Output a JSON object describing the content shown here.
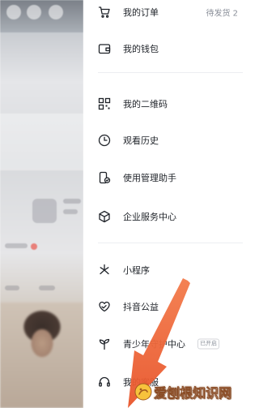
{
  "drawer": {
    "items": [
      {
        "key": "orders",
        "label": "我的订单",
        "icon": "cart-icon",
        "badge": "待发货 2"
      },
      {
        "key": "wallet",
        "label": "我的钱包",
        "icon": "wallet-icon"
      },
      {
        "key": "qrcode",
        "label": "我的二维码",
        "icon": "qrcode-icon"
      },
      {
        "key": "history",
        "label": "观看历史",
        "icon": "clock-icon"
      },
      {
        "key": "guardian",
        "label": "使用管理助手",
        "icon": "phone-shield-icon"
      },
      {
        "key": "enterprise",
        "label": "企业服务中心",
        "icon": "cube-icon"
      },
      {
        "key": "miniprogram",
        "label": "小程序",
        "icon": "asterisk-icon"
      },
      {
        "key": "charity",
        "label": "抖音公益",
        "icon": "heart-hands-icon"
      },
      {
        "key": "youth",
        "label": "青少年守护中心",
        "icon": "sprout-icon",
        "tag": "已开启"
      },
      {
        "key": "support",
        "label": "我的客服",
        "icon": "headset-icon"
      }
    ]
  },
  "watermark": {
    "text": "爱刨根知识网"
  },
  "colors": {
    "arrow": "#f06a3a",
    "divider": "#eceef1",
    "text": "#1f2329",
    "muted": "#8a8f99"
  }
}
